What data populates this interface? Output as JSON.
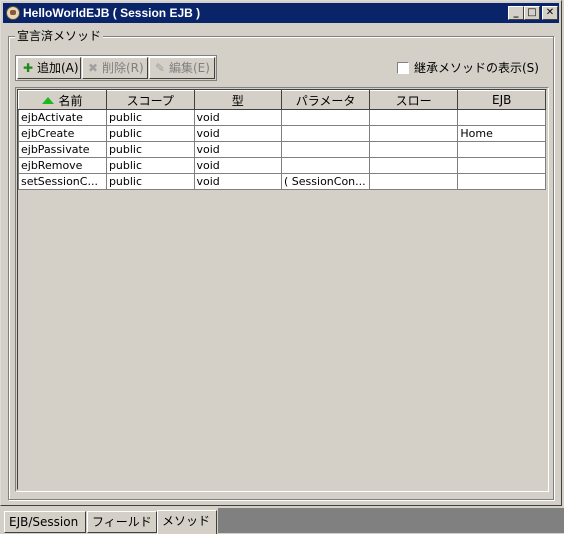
{
  "window": {
    "title": "HelloWorldEJB ( Session EJB )",
    "minimize": "_",
    "maximize": "□",
    "close": "✕",
    "icon": "coffee-cup-icon"
  },
  "group": {
    "legend": "宣言済メソッド"
  },
  "toolbar": {
    "add_label": "追加(A)",
    "delete_label": "削除(R)",
    "edit_label": "編集(E)",
    "add_icon": "plus-icon",
    "delete_icon": "x-icon",
    "edit_icon": "pencil-icon"
  },
  "inherited": {
    "label": "継承メソッドの表示(S)",
    "checked": false
  },
  "table": {
    "columns": [
      "名前",
      "スコープ",
      "型",
      "パラメータ",
      "スロー",
      "EJB"
    ],
    "sort_column": 0,
    "rows": [
      [
        "ejbActivate",
        "public",
        "void",
        "",
        "",
        ""
      ],
      [
        "ejbCreate",
        "public",
        "void",
        "",
        "",
        "Home"
      ],
      [
        "ejbPassivate",
        "public",
        "void",
        "",
        "",
        ""
      ],
      [
        "ejbRemove",
        "public",
        "void",
        "",
        "",
        ""
      ],
      [
        "setSessionC...",
        "public",
        "void",
        "( SessionCon...",
        "",
        ""
      ]
    ]
  },
  "tabs": [
    {
      "label": "EJB/Session",
      "selected": false
    },
    {
      "label": "フィールド",
      "selected": false
    },
    {
      "label": "メソッド",
      "selected": true
    }
  ]
}
